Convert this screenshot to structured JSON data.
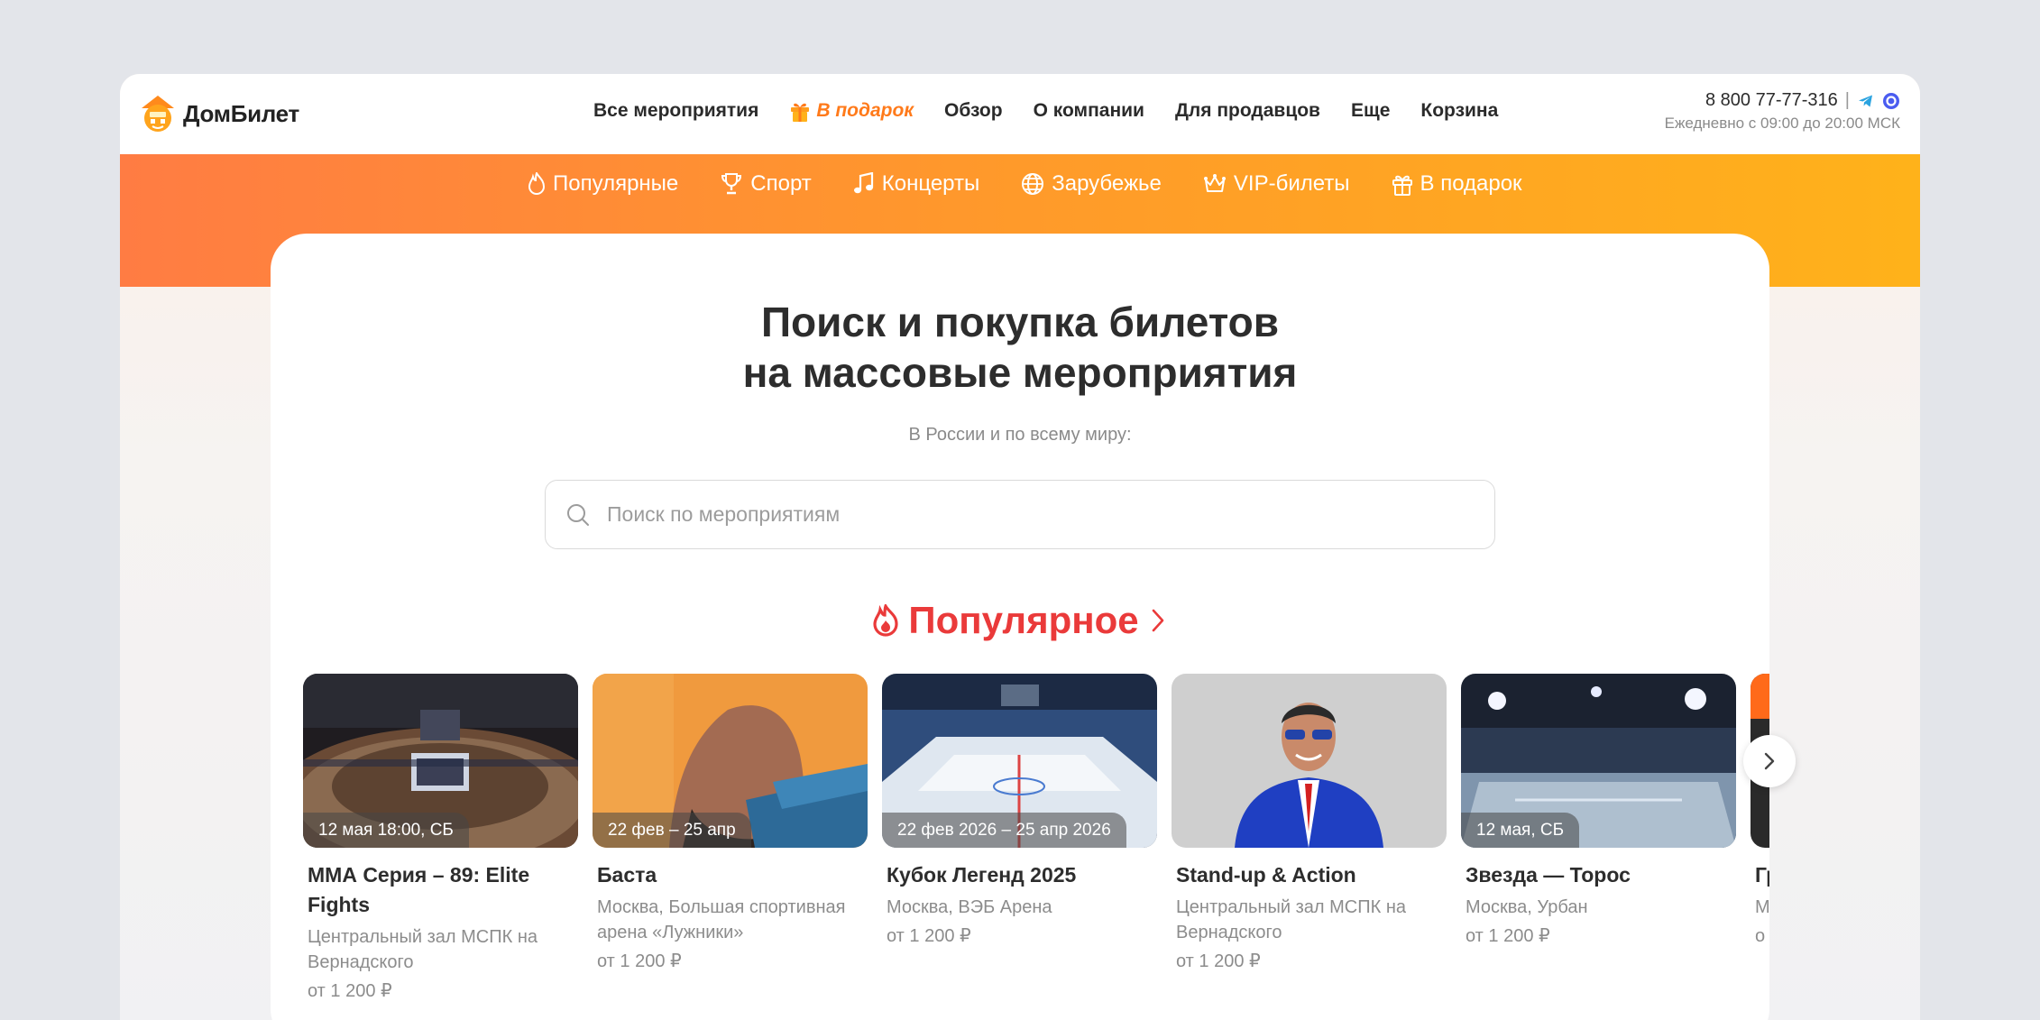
{
  "logo": {
    "text": "ДомБилет"
  },
  "nav": {
    "items": [
      {
        "label": "Все мероприятия"
      },
      {
        "label": "В подарок"
      },
      {
        "label": "Обзор"
      },
      {
        "label": "О компании"
      },
      {
        "label": "Для продавцов"
      },
      {
        "label": "Еще"
      },
      {
        "label": "Корзина"
      }
    ]
  },
  "contact": {
    "phone": "8 800 77-77-316",
    "separator": "|",
    "hours": "Ежедневно с 09:00 до 20:00 МСК"
  },
  "categories": [
    {
      "label": "Популярные",
      "icon": "flame-icon"
    },
    {
      "label": "Спорт",
      "icon": "trophy-icon"
    },
    {
      "label": "Концерты",
      "icon": "music-note-icon"
    },
    {
      "label": "Зарубежье",
      "icon": "globe-icon"
    },
    {
      "label": "VIP-билеты",
      "icon": "crown-icon"
    },
    {
      "label": "В подарок",
      "icon": "gift-icon"
    }
  ],
  "hero": {
    "title_line1": "Поиск и покупка билетов",
    "title_line2": "на массовые мероприятия",
    "subtitle": "В России и по всему миру:"
  },
  "search": {
    "placeholder": "Поиск по мероприятиям",
    "value": ""
  },
  "popular": {
    "title": "Популярное",
    "events": [
      {
        "date": "12 мая 18:00, СБ",
        "title": "ММА Серия – 89: Elite Fights",
        "place": "Центральный зал МСПК на Вернадского",
        "price": "от 1 200 ₽"
      },
      {
        "date": "22 фев – 25 апр",
        "title": "Баста",
        "place": "Москва, Большая спортивная арена «Лужники»",
        "price": "от 1 200 ₽"
      },
      {
        "date": "22 фев 2026 – 25 апр 2026",
        "title": "Кубок Легенд 2025",
        "place": "Москва, ВЭБ Арена",
        "price": "от 1 200 ₽"
      },
      {
        "date": "",
        "title": "Stand-up & Action",
        "place": "Центральный зал МСПК на Вернадского",
        "price": "от 1 200 ₽"
      },
      {
        "date": "12 мая, СБ",
        "title": "Звезда — Торос",
        "place": "Москва, Урбан",
        "price": "от 1 200 ₽"
      },
      {
        "date": "",
        "title": "Гр",
        "place": "М",
        "price": "о"
      }
    ]
  },
  "colors": {
    "accent_orange": "#ff7a1a",
    "popular_red": "#ea3a3a",
    "band_start": "#ff7c43",
    "band_end": "#ffb21a"
  }
}
